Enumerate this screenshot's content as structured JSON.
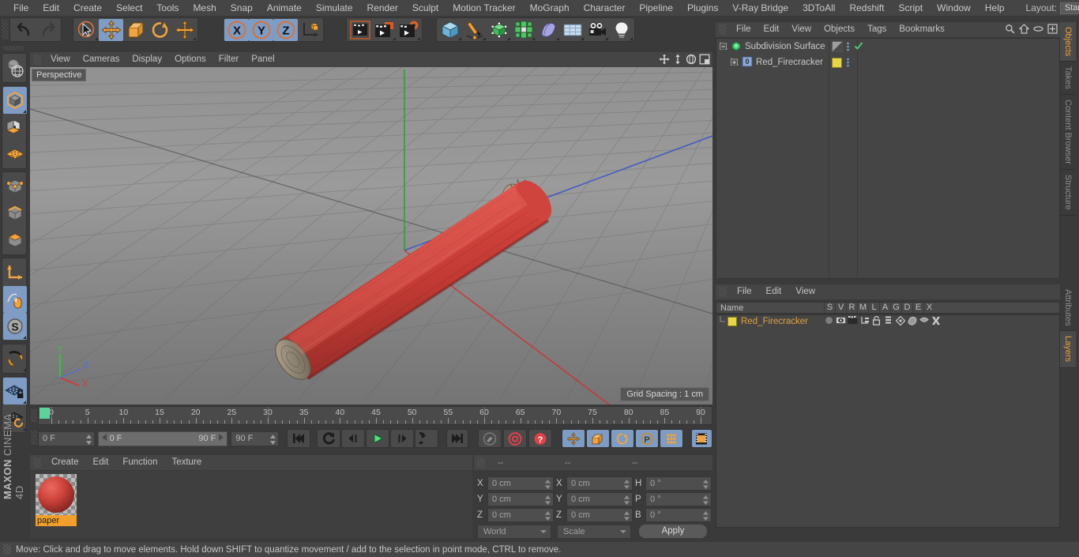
{
  "app": {
    "brand_company": "MAXON",
    "brand_product": "CINEMA 4D"
  },
  "menubar": {
    "items": [
      "File",
      "Edit",
      "Create",
      "Select",
      "Tools",
      "Mesh",
      "Snap",
      "Animate",
      "Simulate",
      "Render",
      "Sculpt",
      "Motion Tracker",
      "MoGraph",
      "Character",
      "Pipeline",
      "Plugins",
      "V-Ray Bridge",
      "3DToAll",
      "Redshift",
      "Script",
      "Window",
      "Help"
    ],
    "layout_label": "Layout:",
    "layout_value": "Startup",
    "search_icon": "search-icon"
  },
  "toolbar": {
    "groups": [
      {
        "name": "history",
        "buttons": [
          {
            "icon": "undo-icon",
            "label": "Undo",
            "active": false
          },
          {
            "icon": "redo-icon",
            "label": "Redo",
            "active": false
          }
        ]
      },
      {
        "name": "tools",
        "buttons": [
          {
            "icon": "live-selection-icon",
            "label": "Live Selection",
            "active": false
          },
          {
            "icon": "move-icon",
            "label": "Move",
            "active": true
          },
          {
            "icon": "scale-icon",
            "label": "Scale",
            "active": false
          },
          {
            "icon": "rotate-icon",
            "label": "Rotate",
            "active": false
          },
          {
            "icon": "move-alt-icon",
            "label": "Move Alt",
            "active": false
          }
        ]
      },
      {
        "name": "axis-locks",
        "buttons": [
          {
            "icon": "x-axis-icon",
            "label": "X",
            "active": true
          },
          {
            "icon": "y-axis-icon",
            "label": "Y",
            "active": true
          },
          {
            "icon": "z-axis-icon",
            "label": "Z",
            "active": true
          },
          {
            "icon": "world-coord-icon",
            "label": "World Coordinates",
            "active": false
          }
        ]
      },
      {
        "name": "render",
        "buttons": [
          {
            "icon": "render-view-icon",
            "label": "Render View",
            "active": false
          },
          {
            "icon": "render-picture-viewer-icon",
            "label": "Render to Picture Viewer",
            "active": false
          },
          {
            "icon": "render-settings-icon",
            "label": "Edit Render Settings",
            "active": false
          }
        ]
      },
      {
        "name": "create",
        "buttons": [
          {
            "icon": "cube-primitive-icon",
            "label": "Cube",
            "active": false
          },
          {
            "icon": "pen-spline-icon",
            "label": "Pen",
            "active": false
          },
          {
            "icon": "generator-icon",
            "label": "Array",
            "active": false
          },
          {
            "icon": "mograph-icon",
            "label": "MoGraph",
            "active": false
          },
          {
            "icon": "deformer-icon",
            "label": "Bend",
            "active": false
          },
          {
            "icon": "scene-environment-icon",
            "label": "Floor",
            "active": false
          },
          {
            "icon": "camera-icon",
            "label": "Camera",
            "active": false
          },
          {
            "icon": "light-icon",
            "label": "Light",
            "active": false
          }
        ]
      }
    ]
  },
  "left_toolbar": {
    "groups": [
      [
        {
          "icon": "axis-globe-icon",
          "label": "Make Editable",
          "active": false
        }
      ],
      [
        {
          "icon": "model-mode-icon",
          "label": "Model Mode",
          "active": true
        },
        {
          "icon": "texture-mode-icon",
          "label": "Texture Mode",
          "active": false
        },
        {
          "icon": "workplane-icon",
          "label": "Workplane",
          "active": false
        }
      ],
      [
        {
          "icon": "points-mode-icon",
          "label": "Points",
          "active": false
        },
        {
          "icon": "edges-mode-icon",
          "label": "Edges",
          "active": false
        },
        {
          "icon": "polygons-mode-icon",
          "label": "Polygons",
          "active": false
        }
      ],
      [
        {
          "icon": "object-axis-icon",
          "label": "Enable Axis",
          "active": false
        },
        {
          "icon": "viewport-solo-icon",
          "label": "Viewport Solo Single",
          "active": true
        },
        {
          "icon": "snap-icon",
          "label": "Enable Snapping",
          "active": true
        }
      ],
      [
        {
          "icon": "magnet-icon",
          "label": "Magnet",
          "active": false
        }
      ],
      [
        {
          "icon": "workplane-lock-icon",
          "label": "Lock Workplane",
          "active": true
        },
        {
          "icon": "workplane-rotate-icon",
          "label": "Planar Workplane",
          "active": false
        }
      ]
    ]
  },
  "viewport": {
    "menu": [
      "View",
      "Cameras",
      "Display",
      "Options",
      "Filter",
      "Panel"
    ],
    "nav_icons": [
      "pan-icon",
      "dolly-icon",
      "orbit-icon",
      "maximize-icon"
    ],
    "label": "Perspective",
    "grid_spacing": "Grid Spacing : 1 cm",
    "axis_labels": {
      "x": "X",
      "y": "Y",
      "z": "Z"
    },
    "axis_colors": {
      "x": "#d03b3b",
      "y": "#3fbe3f",
      "z": "#4a6fe0"
    },
    "object_color": "#d1453f"
  },
  "timeline": {
    "ticks": [
      0,
      5,
      10,
      15,
      20,
      25,
      30,
      35,
      40,
      45,
      50,
      55,
      60,
      65,
      70,
      75,
      80,
      85,
      90
    ],
    "current_frame": "0 F",
    "range_start": "0 F",
    "range_end": "90 F",
    "end_frame": "90 F",
    "frame_field": "0 F",
    "transport": [
      {
        "icon": "go-to-start-icon",
        "label": "Go to Start",
        "active": false
      },
      {
        "icon": "rewind-icon",
        "label": "Play Backwards",
        "active": false
      },
      {
        "icon": "step-back-icon",
        "label": "Previous Frame",
        "active": false
      },
      {
        "icon": "play-icon",
        "label": "Play Forwards",
        "active": false
      },
      {
        "icon": "step-forward-icon",
        "label": "Next Frame",
        "active": false
      },
      {
        "icon": "loop-icon",
        "label": "Play Mode",
        "active": false
      },
      {
        "icon": "go-to-end-icon",
        "label": "Go to End",
        "active": false
      }
    ],
    "keys": [
      {
        "icon": "record-key-icon",
        "label": "Record Active Objects",
        "active": false
      },
      {
        "icon": "autokey-icon",
        "label": "Autokeying",
        "active": false
      },
      {
        "icon": "keyframe-selection-icon",
        "label": "Keyframe Selection",
        "active": false
      }
    ],
    "key_toggles": [
      {
        "icon": "position-key-icon",
        "label": "Position",
        "active": true
      },
      {
        "icon": "scale-key-icon",
        "label": "Scale",
        "active": true
      },
      {
        "icon": "rotation-key-icon",
        "label": "Rotation",
        "active": true
      },
      {
        "icon": "param-key-icon",
        "label": "Parameter",
        "active": true
      },
      {
        "icon": "pla-key-icon",
        "label": "Point Level Animation",
        "active": true
      },
      {
        "icon": "timeline-icon",
        "label": "Timeline",
        "active": true
      }
    ]
  },
  "material_manager": {
    "menu": [
      "Create",
      "Edit",
      "Function",
      "Texture"
    ],
    "materials": [
      {
        "name": "paper",
        "color": "#c8403c",
        "selected": true
      }
    ]
  },
  "coordinates": {
    "headers": [
      "--",
      "--",
      "--"
    ],
    "rows": [
      {
        "pos_label": "X",
        "pos_value": "0 cm",
        "size_label": "X",
        "size_value": "0 cm",
        "rot_label": "H",
        "rot_value": "0 °"
      },
      {
        "pos_label": "Y",
        "pos_value": "0 cm",
        "size_label": "Y",
        "size_value": "0 cm",
        "rot_label": "P",
        "rot_value": "0 °"
      },
      {
        "pos_label": "Z",
        "pos_value": "0 cm",
        "size_label": "Z",
        "size_value": "0 cm",
        "rot_label": "B",
        "rot_value": "0 °"
      }
    ],
    "coord_system": "World",
    "mode": "Scale",
    "apply_label": "Apply"
  },
  "object_manager": {
    "menu": [
      "File",
      "Edit",
      "View",
      "Objects",
      "Tags",
      "Bookmarks"
    ],
    "header_icons": [
      "search-icon",
      "home-icon",
      "ellipse-icon",
      "expand-icon"
    ],
    "rows": [
      {
        "name": "Subdivision Surface",
        "indent": 0,
        "expander": "minus",
        "icon": "subdivision-surface-icon",
        "icon_color": "#3cc36a",
        "tag": "display-tag",
        "check": true
      },
      {
        "name": "Red_Firecracker",
        "indent": 1,
        "expander": "plus",
        "icon": "polygon-object-icon",
        "icon_color": "#8fa9d6",
        "tag": "material-tag",
        "tag_color": "#e8d64a",
        "check": false
      }
    ]
  },
  "layer_manager": {
    "menu": [
      "File",
      "Edit",
      "View"
    ],
    "name_header": "Name",
    "columns": [
      "S",
      "V",
      "R",
      "M",
      "L",
      "A",
      "G",
      "D",
      "E",
      "X"
    ],
    "rows": [
      {
        "name": "Red_Firecracker",
        "color": "#e8d64a",
        "text_color": "#e0a33c"
      }
    ]
  },
  "right_tabs": {
    "top": [
      {
        "label": "Objects",
        "active": true
      },
      {
        "label": "Takes",
        "active": false
      },
      {
        "label": "Content Browser",
        "active": false
      },
      {
        "label": "Structure",
        "active": false
      }
    ],
    "bottom": [
      {
        "label": "Attributes",
        "active": false
      },
      {
        "label": "Layers",
        "active": true
      }
    ]
  },
  "status_bar": {
    "text": "Move: Click and drag to move elements. Hold down SHIFT to quantize movement / add to the selection in point mode, CTRL to remove."
  }
}
